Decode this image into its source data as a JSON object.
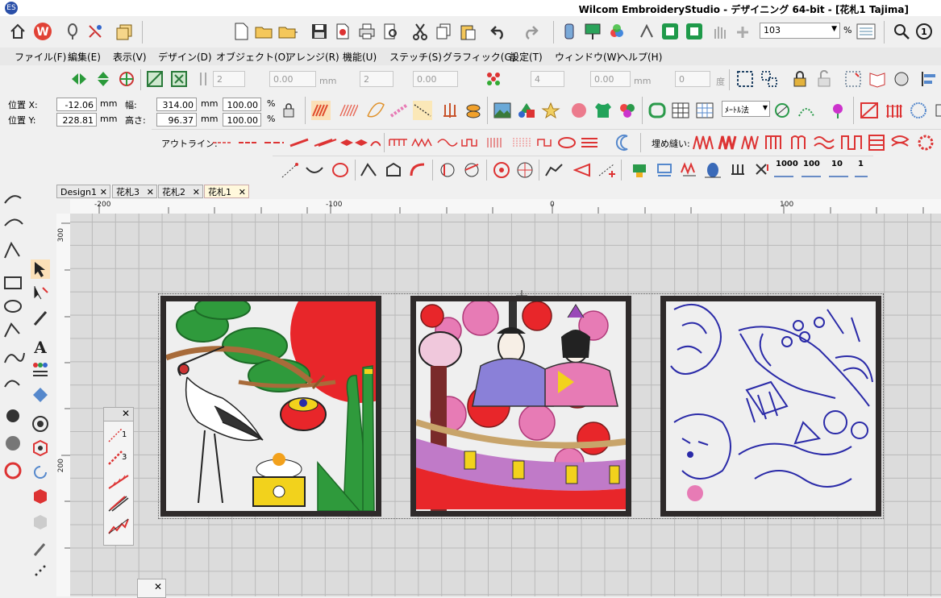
{
  "window": {
    "title": "Wilcom EmbroideryStudio - デザイニング 64-bit - [花札1        Tajima]"
  },
  "toolbar_top": {
    "zoom_value": "103",
    "zoom_unit": "%"
  },
  "menu": {
    "items": [
      "ファイル(F)",
      "編集(E)",
      "表示(V)",
      "デザイン(D)",
      "オブジェクト(O)",
      "アレンジ(R)",
      "機能(U)",
      "ステッチ(S)",
      "グラフィック(G)",
      "設定(T)",
      "ウィンドウ(W)",
      "ヘルプ(H)"
    ]
  },
  "property_bar": {
    "spin1": "2",
    "spin2": "0.00",
    "spin3": "2",
    "spin4": "0.00",
    "spin5": "4",
    "spin6": "0.00",
    "spin7": "0",
    "unit_mm": "mm",
    "unit_deg": "度"
  },
  "object_props": {
    "pos_x_label": "位置 X:",
    "pos_x_value": "-12.06",
    "pos_y_label": "位置 Y:",
    "pos_y_value": "228.81",
    "width_label": "幅:",
    "width_value": "314.00",
    "height_label": "高さ:",
    "height_value": "96.37",
    "unit": "mm",
    "scale_w": "100.00",
    "scale_h": "100.00",
    "pct": "%",
    "measure_select": "ﾒｰﾄﾙ法"
  },
  "outline_bar": {
    "outline_label": "アウトライン:",
    "fill_label": "埋め縫い:"
  },
  "stitch_counts": [
    "1000",
    "100",
    "10",
    "1"
  ],
  "tabs": [
    {
      "label": "Design1"
    },
    {
      "label": "花札3"
    },
    {
      "label": "花札2"
    },
    {
      "label": "花札1",
      "active": true
    }
  ],
  "ruler": {
    "h_labels": [
      "-200",
      "-100",
      "0",
      "100"
    ],
    "v_labels": [
      "300",
      "200"
    ]
  },
  "palette": {
    "items": [
      "1",
      "3"
    ]
  },
  "colors": {
    "canvas": "#dcdcdc",
    "frame": "#2e2a2a",
    "red": "#e8262a",
    "green": "#2f9a3c",
    "blue": "#2a2aa8",
    "pink": "#e77bb5"
  }
}
